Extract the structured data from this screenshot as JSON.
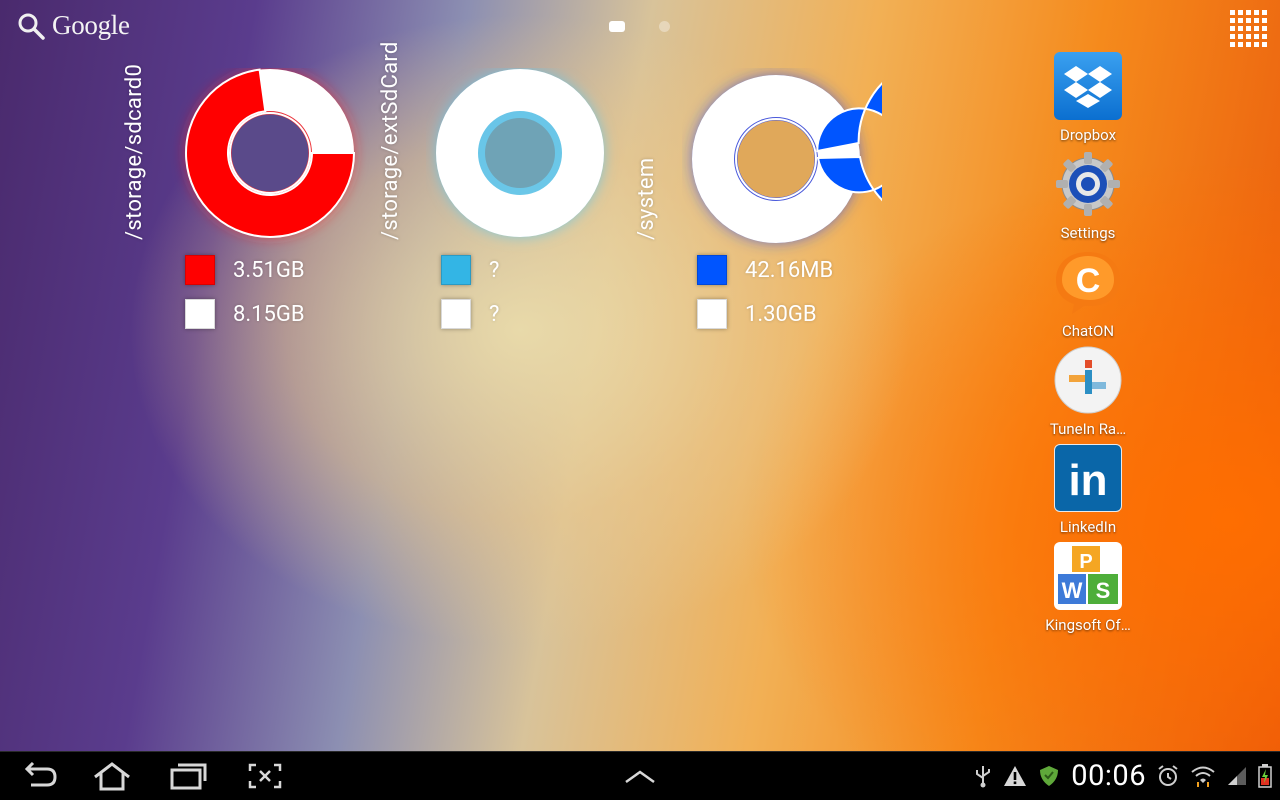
{
  "topbar": {
    "search_label": "Google",
    "pager": [
      "page-1",
      "page-2"
    ],
    "active_page": 0
  },
  "widgets": [
    {
      "path": "/storage/sdcard0",
      "used_color": "#ff0000",
      "free_color": "#ffffff",
      "used_value": "3.51GB",
      "free_value": "8.15GB",
      "glow": "#ff2a2a"
    },
    {
      "path": "/storage/extSdCard",
      "used_color": "#33b5e5",
      "free_color": "#ffffff",
      "used_value": "?",
      "free_value": "?",
      "glow": "#4fc0ea"
    },
    {
      "path": "/system",
      "used_color": "#0055ff",
      "free_color": "#ffffff",
      "used_value": "42.16MB",
      "free_value": "1.30GB",
      "glow": "#2a55ff"
    }
  ],
  "dock": [
    {
      "label": "Dropbox",
      "icon": "dropbox-icon"
    },
    {
      "label": "Settings",
      "icon": "settings-gear-icon"
    },
    {
      "label": "ChatON",
      "icon": "chaton-icon"
    },
    {
      "label": "TuneIn Ra…",
      "icon": "tunein-icon"
    },
    {
      "label": "LinkedIn",
      "icon": "linkedin-icon"
    },
    {
      "label": "Kingsoft Of…",
      "icon": "kingsoft-office-icon"
    }
  ],
  "navbar": {
    "buttons": [
      "back",
      "home",
      "recent-apps",
      "screenshot",
      "menu-up"
    ],
    "clock": "00:06",
    "status_icons": [
      "usb-icon",
      "warning-icon",
      "shield-icon",
      "alarm-icon",
      "wifi-icon",
      "signal-icon",
      "battery-icon"
    ]
  },
  "colors": {
    "legend_white": "#ffffff"
  }
}
